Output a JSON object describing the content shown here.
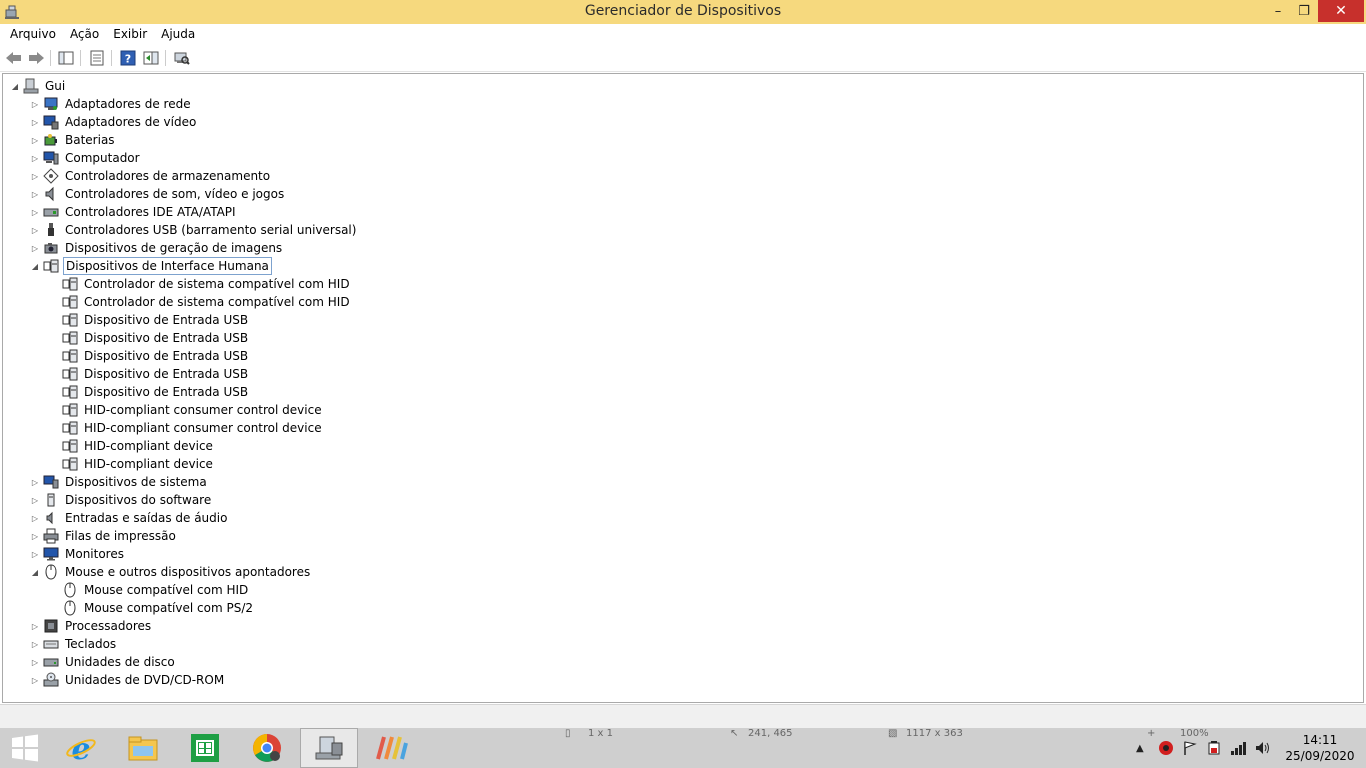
{
  "window": {
    "title": "Gerenciador de Dispositivos",
    "min_glyph": "–",
    "max_glyph": "❐",
    "close_glyph": "✕"
  },
  "menu": {
    "items": [
      "Arquivo",
      "Ação",
      "Exibir",
      "Ajuda"
    ]
  },
  "tree": {
    "root": "Gui",
    "nodes": [
      {
        "label": "Adaptadores de rede",
        "icon": "network-adapter-icon"
      },
      {
        "label": "Adaptadores de vídeo",
        "icon": "display-adapter-icon"
      },
      {
        "label": "Baterias",
        "icon": "battery-icon"
      },
      {
        "label": "Computador",
        "icon": "computer-icon"
      },
      {
        "label": "Controladores de armazenamento",
        "icon": "storage-controller-icon"
      },
      {
        "label": "Controladores de som, vídeo e jogos",
        "icon": "speaker-icon"
      },
      {
        "label": "Controladores IDE ATA/ATAPI",
        "icon": "ide-controller-icon"
      },
      {
        "label": "Controladores USB (barramento serial universal)",
        "icon": "usb-icon"
      },
      {
        "label": "Dispositivos de geração de imagens",
        "icon": "camera-icon"
      },
      {
        "label": "Dispositivos de Interface Humana",
        "icon": "hid-icon"
      },
      {
        "label": "Dispositivos de sistema",
        "icon": "system-device-icon"
      },
      {
        "label": "Dispositivos do software",
        "icon": "software-device-icon"
      },
      {
        "label": "Entradas e saídas de áudio",
        "icon": "audio-io-icon"
      },
      {
        "label": "Filas de impressão",
        "icon": "printer-icon"
      },
      {
        "label": "Monitores",
        "icon": "monitor-icon"
      },
      {
        "label": "Mouse e outros dispositivos apontadores",
        "icon": "mouse-icon"
      },
      {
        "label": "Processadores",
        "icon": "processor-icon"
      },
      {
        "label": "Teclados",
        "icon": "keyboard-icon"
      },
      {
        "label": "Unidades de disco",
        "icon": "disk-drive-icon"
      },
      {
        "label": "Unidades de DVD/CD-ROM",
        "icon": "dvd-drive-icon"
      }
    ],
    "hid_children": [
      "Controlador de sistema compatível com HID",
      "Controlador de sistema compatível com HID",
      "Dispositivo de Entrada USB",
      "Dispositivo de Entrada USB",
      "Dispositivo de Entrada USB",
      "Dispositivo de Entrada USB",
      "Dispositivo de Entrada USB",
      "HID-compliant consumer control device",
      "HID-compliant consumer control device",
      "HID-compliant device",
      "HID-compliant device"
    ],
    "mouse_children": [
      "Mouse compatível com HID",
      "Mouse compatível com PS/2"
    ]
  },
  "taskbar": {
    "ghost_text": [
      "1 x 1",
      "241, 465",
      "1117 x 363",
      "100%"
    ],
    "clock_time": "14:11",
    "clock_date": "25/09/2020"
  },
  "colors": {
    "titlebar": "#f6d97e",
    "close_button": "#c7302c",
    "selection_border": "#7da2ce",
    "taskbar": "#cfcfcf"
  }
}
